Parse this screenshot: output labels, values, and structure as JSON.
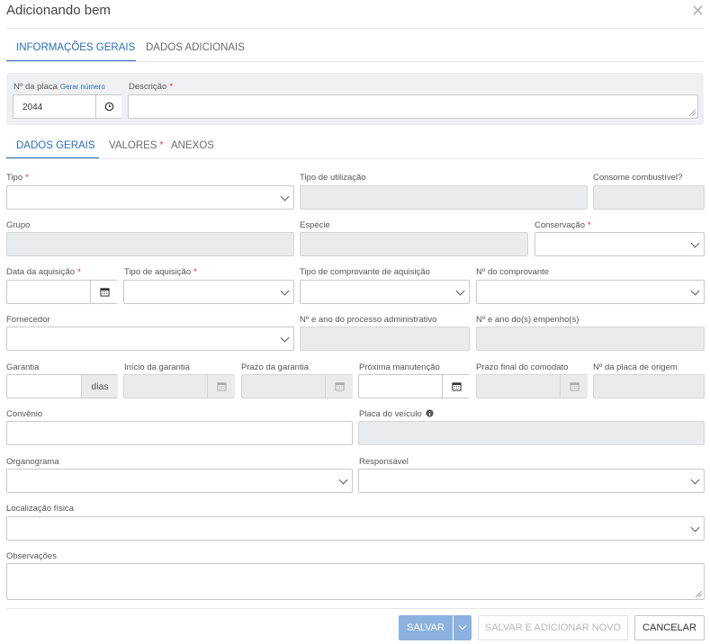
{
  "modal": {
    "title": "Adicionando bem"
  },
  "main_tabs": [
    {
      "label": "INFORMAÇÕES GERAIS",
      "active": true
    },
    {
      "label": "DADOS ADICIONAIS",
      "active": false
    }
  ],
  "header_fields": {
    "placa_label": "Nº da placa",
    "placa_link": "Gerar número",
    "placa_value": "2044",
    "descricao_label": "Descrição"
  },
  "sub_tabs": [
    {
      "label": "DADOS GERAIS",
      "active": true
    },
    {
      "label": "VALORES",
      "active": false,
      "required": true
    },
    {
      "label": "ANEXOS",
      "active": false
    }
  ],
  "form": {
    "tipo": "Tipo",
    "tipo_utilizacao": "Tipo de utilização",
    "consome_combustivel": "Consome combustível?",
    "grupo": "Grupo",
    "especie": "Espécie",
    "conservacao": "Conservação",
    "data_aquisicao": "Data da aquisição",
    "tipo_aquisicao": "Tipo de aquisição",
    "tipo_comprovante": "Tipo de comprovante de aquisição",
    "num_comprovante": "Nº do comprovante",
    "fornecedor": "Fornecedor",
    "processo_admin": "Nº e ano do processo administrativo",
    "empenhos": "Nº e ano do(s) empenho(s)",
    "garantia": "Garantia",
    "garantia_unit": "dias",
    "inicio_garantia": "Início da garantia",
    "prazo_garantia": "Prazo da garantia",
    "proxima_manutencao": "Próxima manutenção",
    "prazo_comodato": "Prazo final do comodato",
    "placa_origem": "Nº da placa de origem",
    "convenio": "Convênio",
    "placa_veiculo": "Placa do veículo",
    "organograma": "Organograma",
    "responsavel": "Responsável",
    "localizacao": "Localização física",
    "observacoes": "Observações"
  },
  "footer": {
    "save": "SALVAR",
    "save_add": "SALVAR E ADICIONAR NOVO",
    "cancel": "CANCELAR"
  },
  "icons": {
    "close": "close-icon",
    "clock": "clock-icon",
    "calendar": "calendar-icon",
    "chevron": "chevron-down-icon",
    "info": "info-icon"
  },
  "colors": {
    "accent": "#2a6ebb",
    "required": "#d9232e",
    "primary_button": "#8cb3df",
    "disabled_field": "#e9ebed",
    "panel": "#eef0f2"
  }
}
